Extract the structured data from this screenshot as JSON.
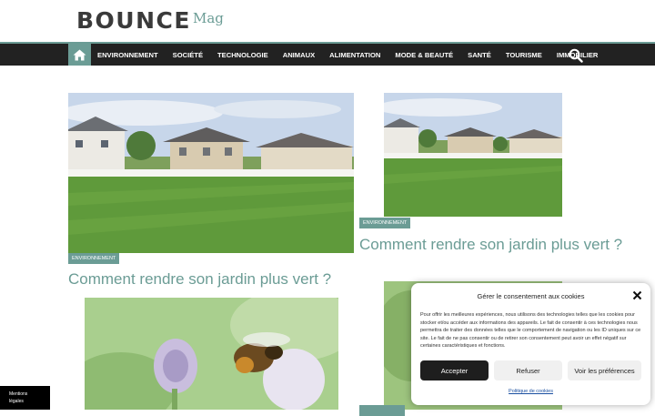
{
  "logo": {
    "main": "BOUNCE",
    "sub": "Mag"
  },
  "nav": {
    "home_icon": "home-icon",
    "items": [
      "ENVIRONNEMENT",
      "SOCIÉTÉ",
      "TECHNOLOGIE",
      "ANIMAUX",
      "ALIMENTATION",
      "MODE & BEAUTÉ",
      "SANTÉ",
      "TOURISME",
      "IMMOBILIER"
    ],
    "search_icon": "search-icon"
  },
  "articles": [
    {
      "category": "ENVIRONNEMENT",
      "title": "Comment rendre son jardin plus vert ?"
    },
    {
      "category": "ENVIRONNEMENT",
      "title": "Comment rendre son jardin plus vert ?"
    }
  ],
  "legal": {
    "line1": "Mentions",
    "line2": "légales"
  },
  "consent": {
    "title": "Gérer le consentement aux cookies",
    "text": "Pour offrir les meilleures expériences, nous utilisons des technologies telles que les cookies pour stocker et/ou accéder aux informations des appareils. Le fait de consentir à ces technologies nous permettra de traiter des données telles que le comportement de navigation ou les ID uniques sur ce site. Le fait de ne pas consentir ou de retirer son consentement peut avoir un effet négatif sur certaines caractéristiques et fonctions.",
    "accept": "Accepter",
    "refuse": "Refuser",
    "preferences": "Voir les préférences",
    "policy": "Politique de cookies",
    "close_icon": "close-icon"
  },
  "colors": {
    "accent": "#6b9c95",
    "nav_bg": "#222222",
    "button_dark": "#1e1e1e"
  }
}
